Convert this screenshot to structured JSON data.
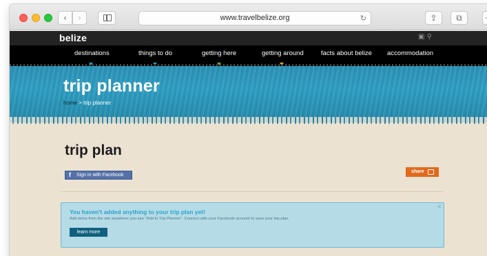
{
  "browser": {
    "url": "www.travelbelize.org",
    "back_icon": "‹",
    "forward_icon": "›",
    "reload_icon": "↻",
    "share_icon": "⇪",
    "tabs_icon": "⧉",
    "new_tab_icon": "+"
  },
  "site": {
    "logo": "belize",
    "top_icons": "▣  ⚲",
    "nav": [
      {
        "label": "destinations",
        "dot_color": "#2aa3c8"
      },
      {
        "label": "things to do",
        "dot_color": "#2aa3c8"
      },
      {
        "label": "getting here",
        "dot_color": "#6bb43c"
      },
      {
        "label": "getting around",
        "dot_color": "#f2b53b"
      },
      {
        "label": "facts about belize",
        "dot_color": ""
      },
      {
        "label": "accommodation",
        "dot_color": ""
      }
    ]
  },
  "hero": {
    "title": "trip planner",
    "breadcrumb_home": "home",
    "breadcrumb_sep": " > ",
    "breadcrumb_current": "trip planner"
  },
  "plan": {
    "title": "trip plan",
    "facebook_icon": "f",
    "facebook_label": "Sign in with Facebook",
    "share_label": "share"
  },
  "alert": {
    "title": "You haven't added anything to your trip plan yet!",
    "message": "Add items from the site anywhere you see \"Add to Trip Planner\". Connect with your Facebook account to save your trip plan.",
    "close": "×",
    "button": "learn more"
  },
  "colors": {
    "nav_bg": "#000000",
    "hero_blue": "#2e9ec3",
    "page_bg": "#ebe2d2",
    "share_orange": "#e16a1d",
    "facebook_blue": "#5571a9",
    "alert_bg": "#b5dbe7",
    "button_dark": "#0f607e"
  }
}
